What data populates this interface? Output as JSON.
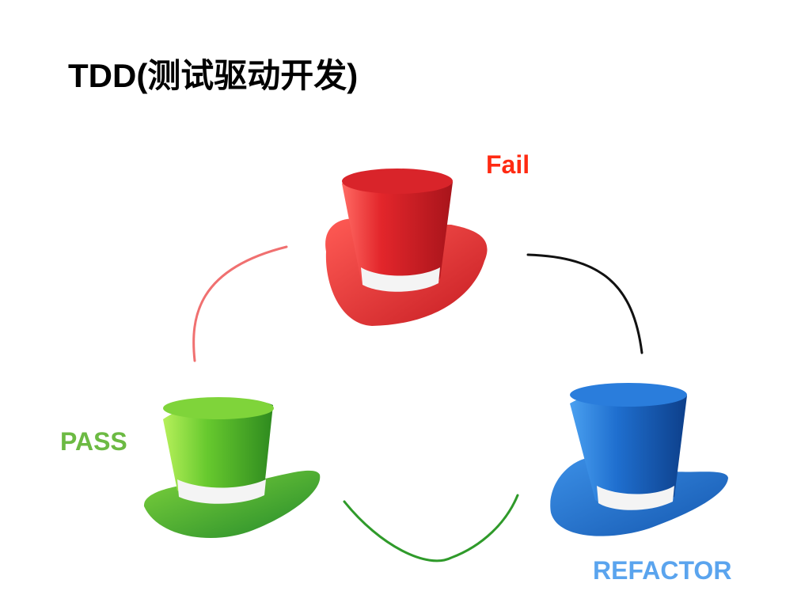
{
  "slide": {
    "title": "TDD(测试驱动开发)"
  },
  "stages": {
    "fail": {
      "label": "Fail",
      "color": "#ff2a12"
    },
    "pass": {
      "label": "PASS",
      "color": "#6cba43"
    },
    "refactor": {
      "label": "REFACTOR",
      "color": "#5aa4ee"
    }
  },
  "hats": {
    "red": {
      "icon": "red-top-hat-icon",
      "color": "#e0282a"
    },
    "green": {
      "icon": "green-top-hat-icon",
      "color": "#4db02e"
    },
    "blue": {
      "icon": "blue-top-hat-icon",
      "color": "#1f6fc8"
    }
  },
  "connectors": {
    "red": "#f07070",
    "black": "#111111",
    "green": "#2f9a2a"
  }
}
